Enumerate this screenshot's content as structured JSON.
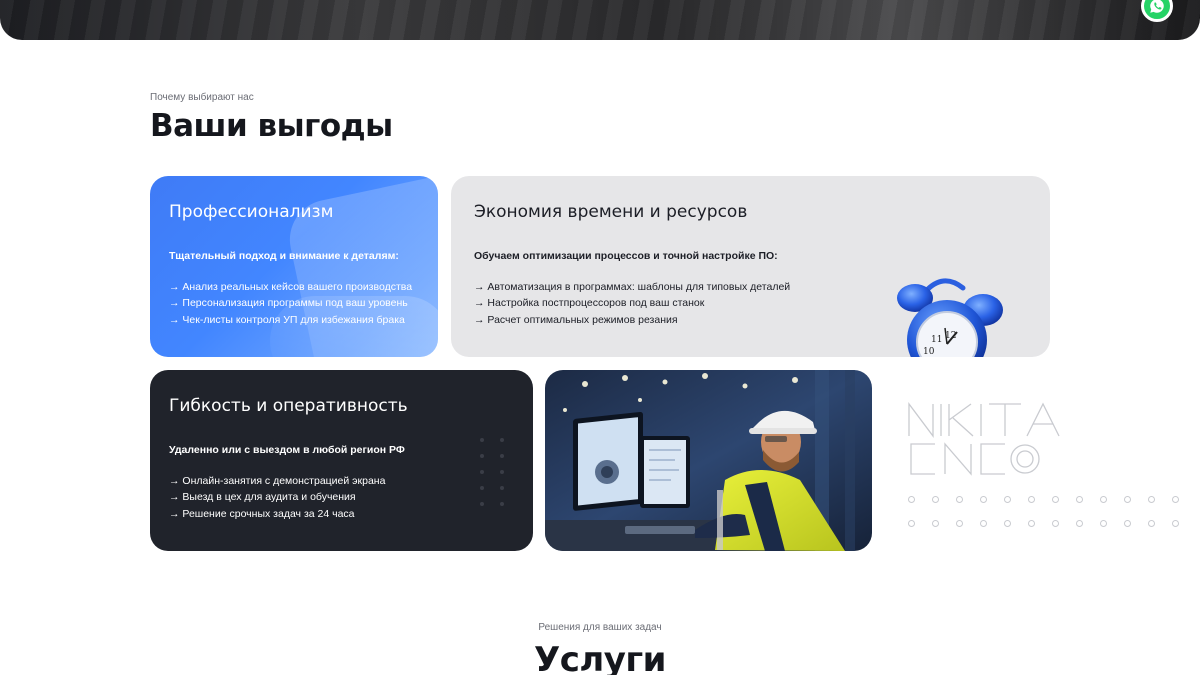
{
  "benefits": {
    "eyebrow": "Почему выбирают нас",
    "title": "Ваши выгоды",
    "cards": [
      {
        "title": "Профессионализм",
        "lead": "Тщательный подход и внимание к деталям:",
        "items": [
          "→ Анализ реальных кейсов вашего производства",
          "→ Персонализация программы под ваш уровень",
          "→ Чек-листы контроля УП для избежания брака"
        ]
      },
      {
        "title": "Экономия времени и ресурсов",
        "lead": "Обучаем оптимизации процессов и точной настройке ПО:",
        "items": [
          "→ Автоматизация в программах: шаблоны для типовых деталей",
          "→ Настройка постпроцессоров под ваш станок",
          "→ Расчет оптимальных режимов резания"
        ]
      },
      {
        "title": "Гибкость и оперативность",
        "lead": "Удаленно или с выездом в любой регион РФ",
        "items": [
          "→ Онлайн-занятия с демонстрацией экрана",
          "→ Выезд в цех для аудита и обучения",
          "→ Решение срочных задач за 24 часа"
        ]
      }
    ],
    "brand_line1": "NIKITA",
    "brand_line2": "CNC"
  },
  "services": {
    "eyebrow": "Решения для ваших задач",
    "title": "Услуги"
  },
  "icons": {
    "messenger": "whatsapp-icon",
    "clock": "alarm-clock-icon"
  },
  "colors": {
    "accent_blue": "#3f7bf6",
    "card_gray": "#e6e6e8",
    "card_dark": "#20232b",
    "whatsapp": "#25d366"
  }
}
